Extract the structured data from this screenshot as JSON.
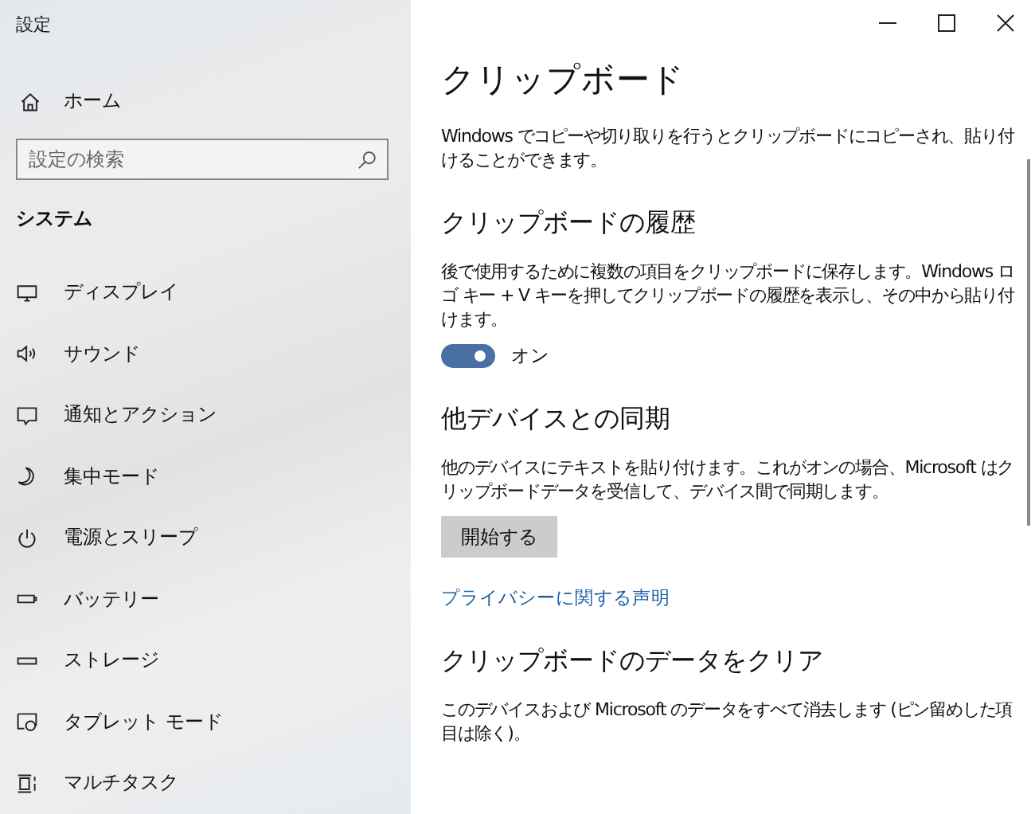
{
  "window": {
    "title": "設定"
  },
  "sidebar": {
    "home": "ホーム",
    "search": {
      "placeholder": "設定の検索"
    },
    "section": "システム",
    "items": [
      {
        "label": "ディスプレイ",
        "selected": false
      },
      {
        "label": "サウンド",
        "selected": false
      },
      {
        "label": "通知とアクション",
        "selected": false
      },
      {
        "label": "集中モード",
        "selected": false
      },
      {
        "label": "電源とスリープ",
        "selected": false
      },
      {
        "label": "バッテリー",
        "selected": false
      },
      {
        "label": "ストレージ",
        "selected": false
      },
      {
        "label": "タブレット モード",
        "selected": false
      },
      {
        "label": "マルチタスク",
        "selected": false
      }
    ]
  },
  "page": {
    "title": "クリップボード",
    "intro": "Windows でコピーや切り取りを行うとクリップボードにコピーされ、貼り付けることができます。",
    "sections": [
      {
        "kind": "toggle",
        "heading": "クリップボードの履歴",
        "text": "後で使用するために複数の項目をクリップボードに保存します。Windows ロゴ キー + V キーを押してクリップボードの履歴を表示し、その中から貼り付けます。",
        "on": true,
        "state_label": "オン"
      },
      {
        "kind": "button",
        "heading": "他デバイスとの同期",
        "text": "他のデバイスにテキストを貼り付けます。これがオンの場合、Microsoft はクリップボードデータを受信して、デバイス間で同期します。",
        "button": "開始する",
        "link": "プライバシーに関する声明"
      },
      {
        "kind": "text",
        "heading": "クリップボードのデータをクリア",
        "text": "このデバイスおよび Microsoft のデータをすべて消去します (ピン留めした項目は除く)。"
      }
    ]
  }
}
